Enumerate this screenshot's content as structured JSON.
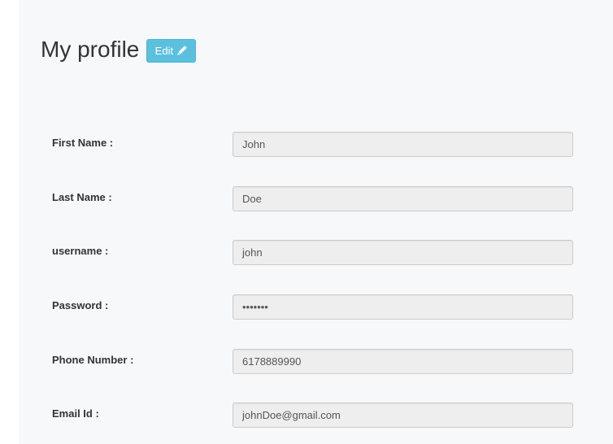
{
  "header": {
    "title": "My profile",
    "edit_label": "Edit"
  },
  "form": {
    "fields": [
      {
        "label": "First Name :",
        "value": "John"
      },
      {
        "label": "Last Name :",
        "value": "Doe"
      },
      {
        "label": "username :",
        "value": "john"
      },
      {
        "label": "Password :",
        "value": "•••••••"
      },
      {
        "label": "Phone Number :",
        "value": "6178889990"
      },
      {
        "label": "Email Id :",
        "value": "johnDoe@gmail.com"
      }
    ]
  },
  "colors": {
    "panel_bg": "#f7f8fa",
    "edit_button": "#5bc0de",
    "input_bg": "#eeeeee",
    "input_border": "#cccccc"
  },
  "icons": {
    "edit": "pencil-icon"
  }
}
